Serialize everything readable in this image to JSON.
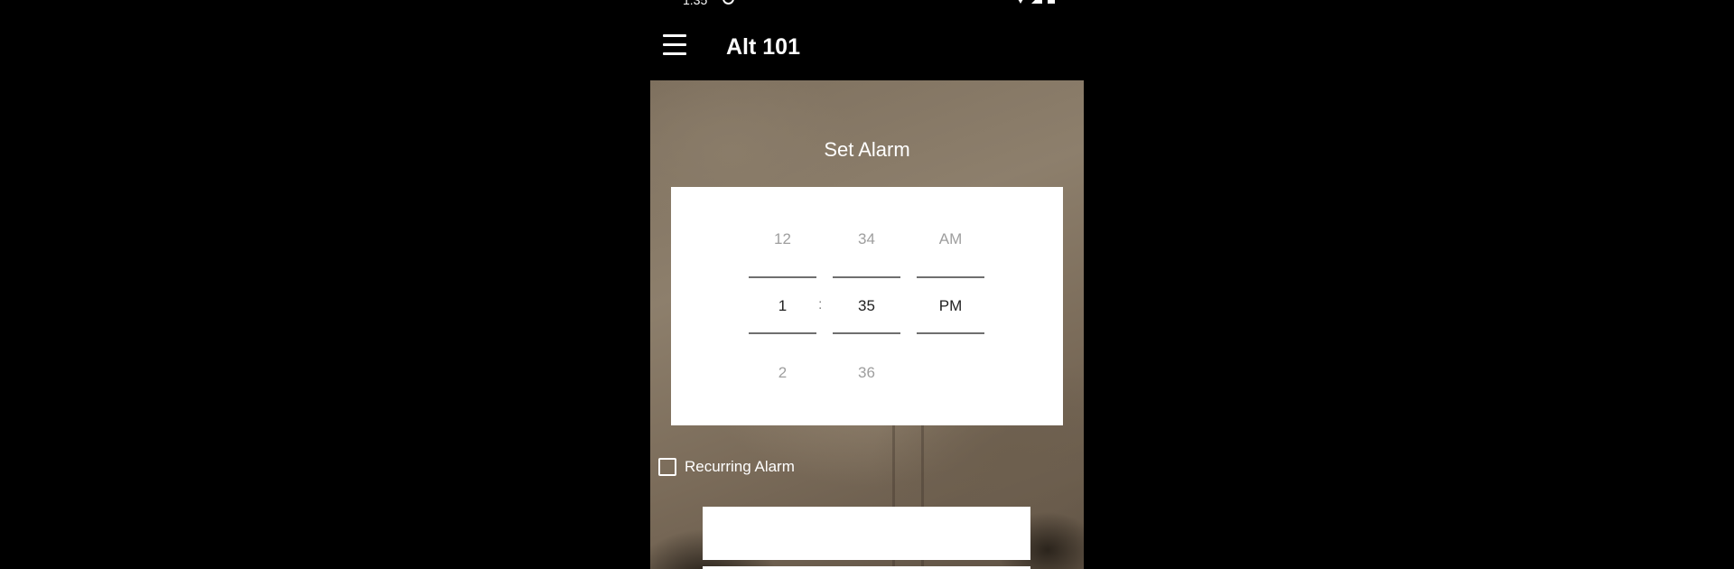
{
  "status_bar": {
    "time": "1:35"
  },
  "app_bar": {
    "title": "Alt 101"
  },
  "alarm": {
    "heading": "Set Alarm",
    "picker": {
      "hour": {
        "prev": "12",
        "current": "1",
        "next": "2"
      },
      "minute": {
        "prev": "34",
        "current": "35",
        "next": "36"
      },
      "separator": ":",
      "ampm": {
        "prev": "AM",
        "current": "PM"
      }
    },
    "recurring_label": "Recurring Alarm",
    "recurring_checked": false
  },
  "colors": {
    "background": "#000000",
    "card": "#ffffff",
    "picker_inactive_text": "#9e9e9e",
    "picker_active_text": "#222222"
  }
}
